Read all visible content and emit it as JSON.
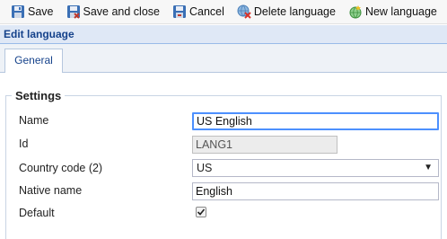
{
  "toolbar": {
    "save_label": "Save",
    "save_close_label": "Save and close",
    "cancel_label": "Cancel",
    "delete_label": "Delete language",
    "new_label": "New language"
  },
  "header": {
    "title": "Edit language"
  },
  "tabs": [
    {
      "label": "General"
    }
  ],
  "settings": {
    "legend": "Settings",
    "name": {
      "label": "Name",
      "value": "US English"
    },
    "id": {
      "label": "Id",
      "value": "LANG1"
    },
    "country_code": {
      "label": "Country code (2)",
      "value": "US"
    },
    "native_name": {
      "label": "Native name",
      "value": "English"
    },
    "default": {
      "label": "Default",
      "checked": true
    }
  },
  "colors": {
    "header_bg": "#dfe8f6",
    "header_text": "#15428b",
    "focus": "#4d90fe"
  }
}
